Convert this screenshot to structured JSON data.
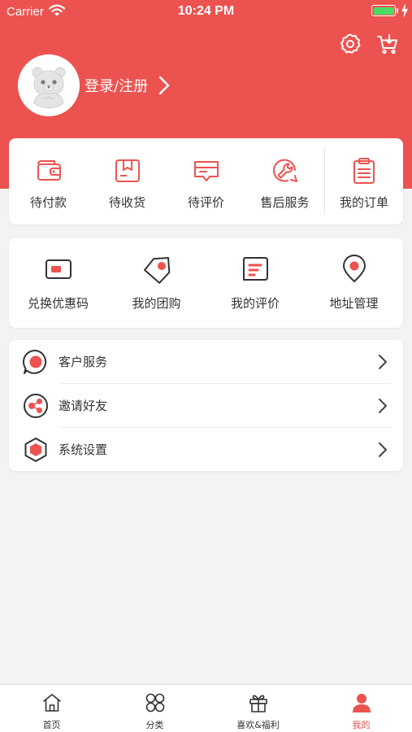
{
  "status_bar": {
    "carrier": "Carrier",
    "time": "10:24 PM"
  },
  "header": {
    "login_label": "登录/注册"
  },
  "orders": [
    {
      "label": "待付款",
      "icon": "wallet-icon"
    },
    {
      "label": "待收货",
      "icon": "package-icon"
    },
    {
      "label": "待评价",
      "icon": "review-icon"
    },
    {
      "label": "售后服务",
      "icon": "wrench-icon"
    },
    {
      "label": "我的订单",
      "icon": "clipboard-icon"
    }
  ],
  "tools": [
    {
      "label": "兑换优惠码",
      "icon": "coupon-icon"
    },
    {
      "label": "我的团购",
      "icon": "tag-icon"
    },
    {
      "label": "我的评价",
      "icon": "comment-icon"
    },
    {
      "label": "地址管理",
      "icon": "location-pin-icon"
    }
  ],
  "menu": [
    {
      "label": "客户服务",
      "icon": "customer-service-icon"
    },
    {
      "label": "邀请好友",
      "icon": "share-icon"
    },
    {
      "label": "系统设置",
      "icon": "hexagon-settings-icon"
    }
  ],
  "tabbar": [
    {
      "label": "首页",
      "icon": "home-icon",
      "active": false
    },
    {
      "label": "分类",
      "icon": "category-icon",
      "active": false
    },
    {
      "label": "喜欢&福利",
      "icon": "gift-icon",
      "active": false
    },
    {
      "label": "我的",
      "icon": "user-icon",
      "active": true
    }
  ],
  "colors": {
    "brand": "#ec5350",
    "battery": "#4cd964",
    "background": "#f3f3f3"
  }
}
